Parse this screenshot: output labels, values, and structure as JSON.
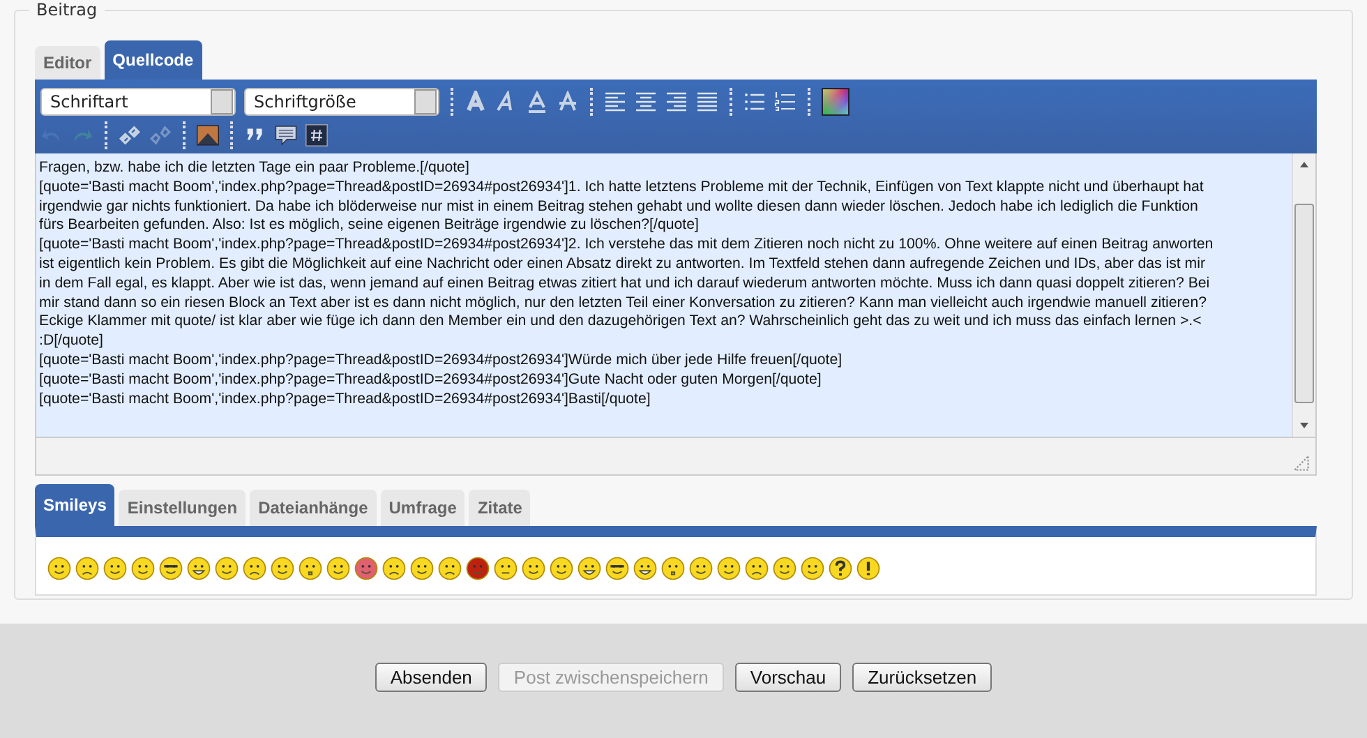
{
  "fieldset": {
    "legend": "Beitrag"
  },
  "editor_tabs": [
    {
      "label": "Editor",
      "selected": false
    },
    {
      "label": "Quellcode",
      "selected": true
    }
  ],
  "toolbar": {
    "font_select": "Schriftart",
    "size_select": "Schriftgröße",
    "buttons": [
      {
        "kind": "undo",
        "disabled": true
      },
      {
        "kind": "redo",
        "disabled": true
      },
      {
        "kind": "link",
        "disabled": false
      },
      {
        "kind": "unlink",
        "disabled": true
      },
      {
        "kind": "image",
        "disabled": false
      },
      {
        "kind": "quote",
        "disabled": false
      },
      {
        "kind": "comment",
        "disabled": false
      },
      {
        "kind": "code",
        "disabled": false
      }
    ]
  },
  "source_lines": [
    "Fragen, bzw. habe ich die letzten Tage ein paar Probleme.[/quote]",
    "[quote='Basti macht Boom','index.php?page=Thread&postID=26934#post26934']1. Ich hatte letztens Probleme mit der Technik, Einfügen von Text klappte nicht und überhaupt hat",
    "irgendwie gar nichts funktioniert. Da habe ich blöderweise nur mist in einem Beitrag stehen gehabt und wollte diesen dann wieder löschen. Jedoch habe ich lediglich die Funktion",
    "fürs Bearbeiten gefunden. Also: Ist es möglich, seine eigenen Beiträge irgendwie zu löschen?[/quote]",
    "[quote='Basti macht Boom','index.php?page=Thread&postID=26934#post26934']2. Ich verstehe das mit dem Zitieren noch nicht zu 100%. Ohne weitere auf einen Beitrag anworten",
    "ist eigentlich kein Problem. Es gibt die Möglichkeit auf eine Nachricht oder einen Absatz direkt zu antworten. Im Textfeld stehen dann aufregende Zeichen und IDs, aber das ist mir",
    "in dem Fall egal, es klappt. Aber wie ist das, wenn jemand auf einen Beitrag etwas zitiert hat und ich darauf wiederum antworten möchte. Muss ich dann quasi doppelt zitieren? Bei",
    "mir stand dann so ein riesen Block an Text aber ist es dann nicht möglich, nur den letzten Teil einer Konversation zu zitieren? Kann man vielleicht auch irgendwie manuell zitieren?",
    "Eckige Klammer mit quote/ ist klar aber wie füge ich dann den Member ein und den dazugehörigen Text an? Wahrscheinlich geht das zu weit und ich muss das einfach lernen >.<",
    ":D[/quote]",
    "[quote='Basti macht Boom','index.php?page=Thread&postID=26934#post26934']Würde mich über jede Hilfe freuen[/quote]",
    "[quote='Basti macht Boom','index.php?page=Thread&postID=26934#post26934']Gute Nacht oder guten Morgen[/quote]",
    "[quote='Basti macht Boom','index.php?page=Thread&postID=26934#post26934']Basti[/quote]"
  ],
  "option_tabs": [
    {
      "label": "Smileys",
      "selected": true
    },
    {
      "label": "Einstellungen",
      "selected": false
    },
    {
      "label": "Dateianhänge",
      "selected": false
    },
    {
      "label": "Umfrage",
      "selected": false
    },
    {
      "label": "Zitate",
      "selected": false
    }
  ],
  "buttons": [
    {
      "label": "Absenden",
      "disabled": false
    },
    {
      "label": "Post zwischenspeichern",
      "disabled": true
    },
    {
      "label": "Vorschau",
      "disabled": false
    },
    {
      "label": "Zurücksetzen",
      "disabled": false
    }
  ]
}
